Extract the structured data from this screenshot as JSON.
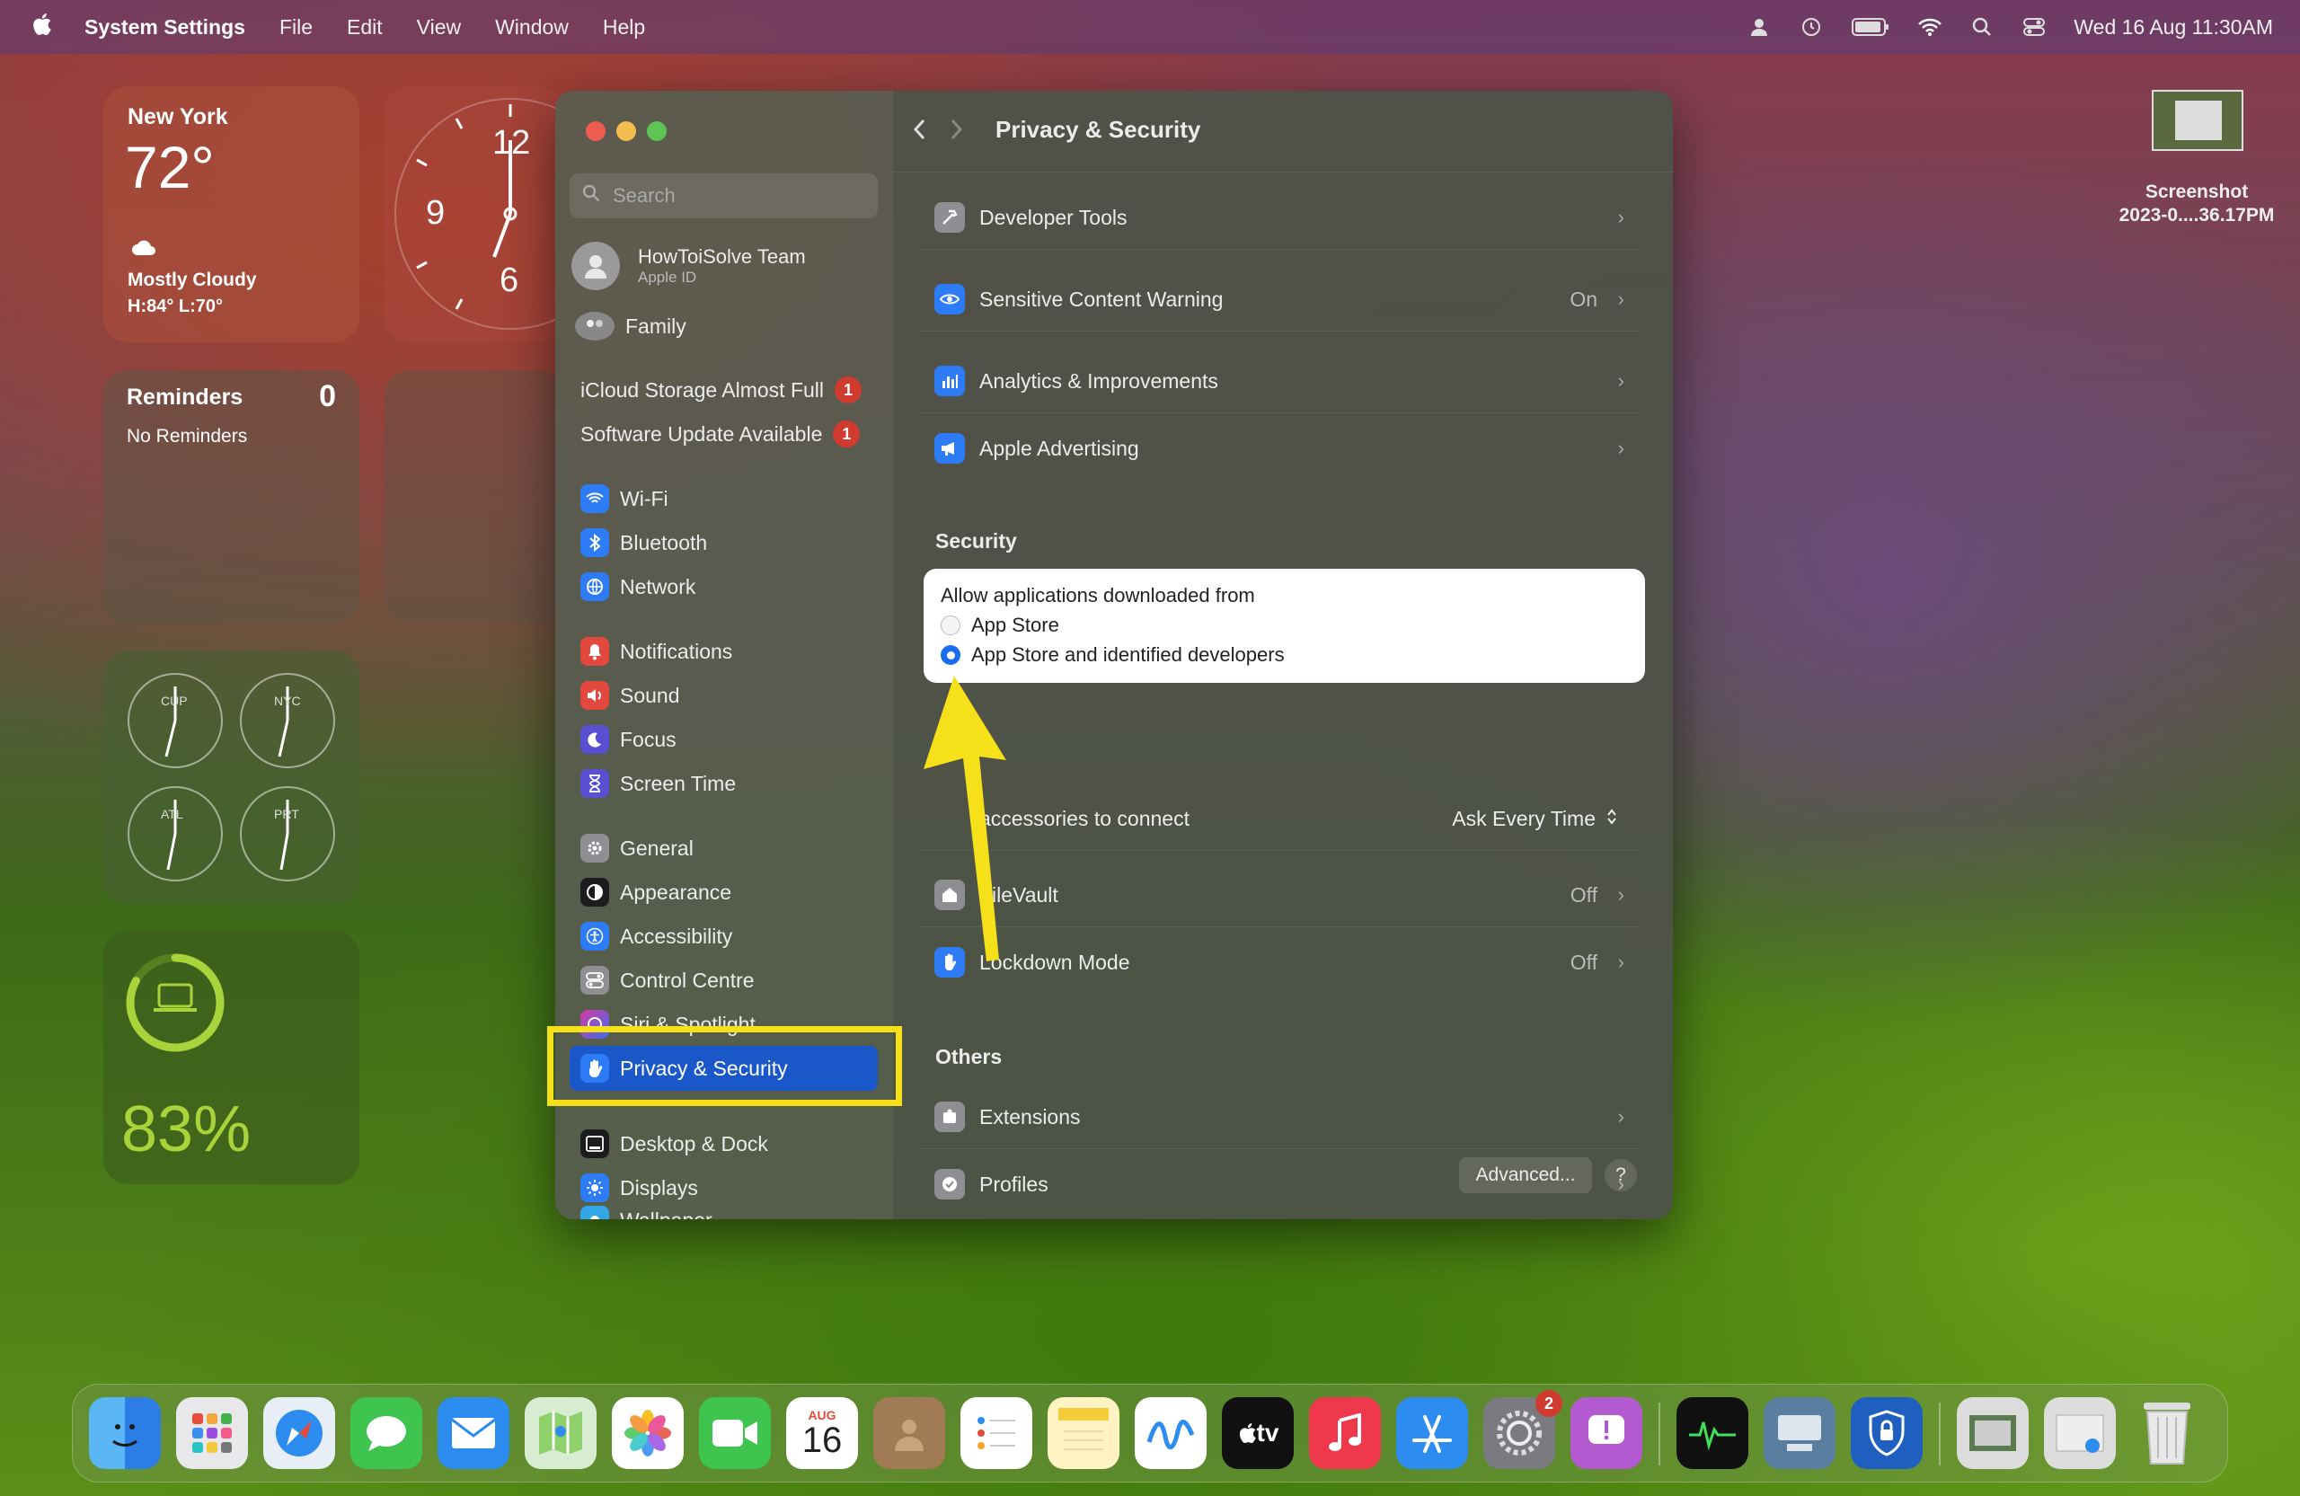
{
  "menubar": {
    "app_name": "System Settings",
    "menus": [
      "File",
      "Edit",
      "View",
      "Window",
      "Help"
    ],
    "clock": "Wed 16 Aug  11:30AM"
  },
  "widgets": {
    "weather": {
      "city": "New York",
      "temp": "72°",
      "condition": "Mostly Cloudy",
      "range": "H:84° L:70°"
    },
    "clock_numbers": {
      "twelve": "12",
      "nine": "9",
      "six": "6"
    },
    "reminders": {
      "title": "Reminders",
      "count": "0",
      "empty": "No Reminders"
    },
    "world_clock": {
      "cities": [
        "CUP",
        "NYC",
        "ATL",
        "PRT"
      ]
    },
    "battery": {
      "level": 0.83,
      "label": "83%"
    }
  },
  "desktop_file": {
    "name_line1": "Screenshot",
    "name_line2": "2023-0....36.17PM"
  },
  "window": {
    "search_placeholder": "Search",
    "account": {
      "name": "HowToiSolve Team",
      "sub": "Apple ID"
    },
    "family": "Family",
    "alerts": [
      {
        "label": "iCloud Storage Almost Full",
        "badge": "1"
      },
      {
        "label": "Software Update Available",
        "badge": "1"
      }
    ],
    "sidebar_groups": {
      "network": [
        "Wi-Fi",
        "Bluetooth",
        "Network"
      ],
      "notify": [
        "Notifications",
        "Sound",
        "Focus",
        "Screen Time"
      ],
      "system": [
        "General",
        "Appearance",
        "Accessibility",
        "Control Centre",
        "Siri & Spotlight",
        "Privacy & Security"
      ],
      "display": [
        "Desktop & Dock",
        "Displays",
        "Wallpaper"
      ]
    },
    "title": "Privacy & Security",
    "rows_top": [
      {
        "label": "Developer Tools",
        "value": ""
      },
      {
        "label": "Sensitive Content Warning",
        "value": "On"
      },
      {
        "label": "Analytics & Improvements",
        "value": ""
      },
      {
        "label": "Apple Advertising",
        "value": ""
      }
    ],
    "security_title": "Security",
    "allow_title": "Allow applications downloaded from",
    "allow_options": [
      "App Store",
      "App Store and identified developers"
    ],
    "allow_selected": "App Store and identified developers",
    "accessories": {
      "label": "accessories to connect",
      "value": "Ask Every Time"
    },
    "filevault": {
      "label": "FileVault",
      "value": "Off"
    },
    "lockdown": {
      "label": "Lockdown Mode",
      "value": "Off"
    },
    "others_title": "Others",
    "others": [
      "Extensions",
      "Profiles"
    ],
    "advanced_button": "Advanced...",
    "help_button": "?"
  },
  "dock": {
    "calendar_month": "AUG",
    "calendar_day": "16",
    "settings_badge": "2",
    "tv_label": "tv"
  },
  "colors": {
    "accent_blue": "#1a6cf0",
    "badge_red": "#d13a2f",
    "highlight_yellow": "#f5e01a"
  }
}
